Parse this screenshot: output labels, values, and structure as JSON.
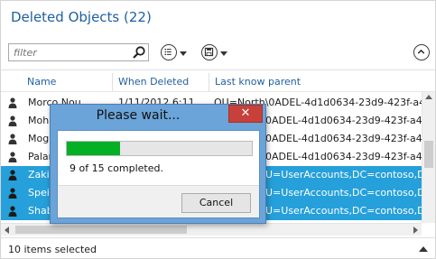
{
  "window": {
    "title": "Deleted Objects  (22)"
  },
  "toolbar": {
    "filter_placeholder": "filter",
    "filter_value": ""
  },
  "columns": [
    "Name",
    "When Deleted",
    "Last know parent"
  ],
  "rows": [
    {
      "name": "Morco Nou",
      "when": "1/11/2012 6:11",
      "parent": "OU=North\\0ADEL-4d1d0634-23d9-423f-a4a4...",
      "selected": false
    },
    {
      "name": "Moha",
      "when": "",
      "parent": "0ADEL-4d1d0634-23d9-423f-a4a4...",
      "selected": false
    },
    {
      "name": "Mogn",
      "when": "",
      "parent": "0ADEL-4d1d0634-23d9-423f-a4a4...",
      "selected": false
    },
    {
      "name": "Palan",
      "when": "",
      "parent": "0ADEL-4d1d0634-23d9-423f-a4a4...",
      "selected": false
    },
    {
      "name": "Zaki A",
      "when": "",
      "parent": "U=UserAccounts,DC=contoso,DC=...",
      "selected": true
    },
    {
      "name": "Speir",
      "when": "",
      "parent": "U=UserAccounts,DC=contoso,DC=...",
      "selected": true
    },
    {
      "name": "Shaba",
      "when": "",
      "parent": "U=UserAccounts,DC=contoso,DC=...",
      "selected": true
    }
  ],
  "status": {
    "text": "10 items selected"
  },
  "dialog": {
    "title": "Please wait...",
    "close_glyph": "✕",
    "progress_fraction": 0.29,
    "progress_text": "9 of 15 completed.",
    "cancel_label": "Cancel"
  },
  "colors": {
    "title": "#1f5f9f",
    "selection": "#26a0da",
    "progress_fill": "#06b025",
    "dialog_frame": "#6ba4d8",
    "close_button": "#c7413a"
  },
  "icons": {
    "search": "search-icon",
    "view_options": "list-options-icon",
    "save_options": "save-icon",
    "collapse": "chevron-up-icon",
    "user": "user-icon",
    "close": "close-icon"
  }
}
